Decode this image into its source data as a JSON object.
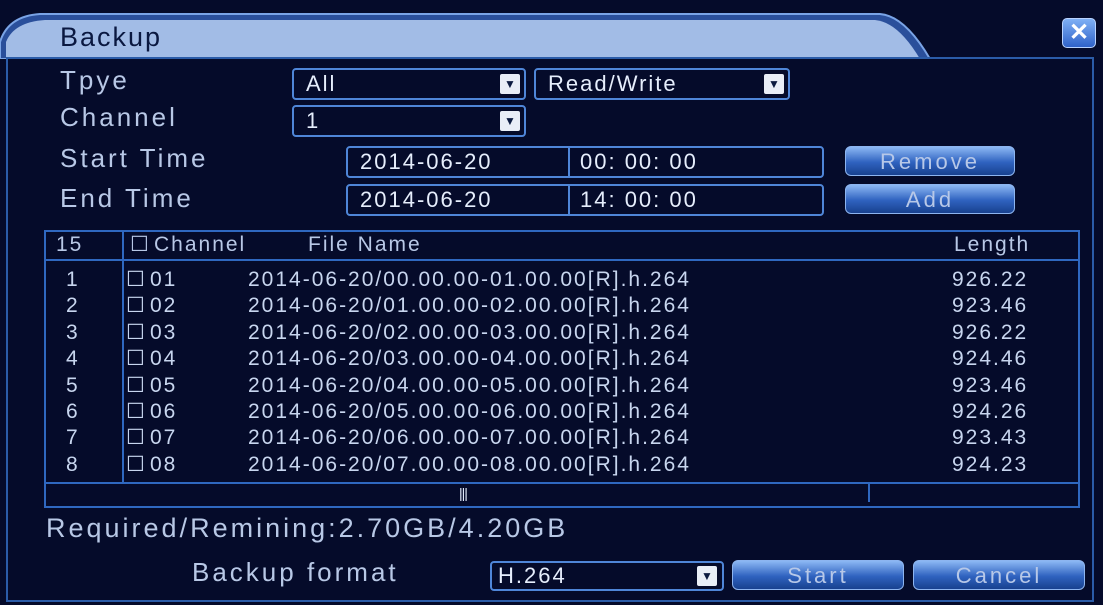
{
  "window": {
    "title": "Backup"
  },
  "form": {
    "type_label": "Tpye",
    "type_value": "All",
    "mode_value": "Read/Write",
    "channel_label": "Channel",
    "channel_value": "1",
    "start_label": "Start Time",
    "start_date": "2014-06-20",
    "start_time": "00: 00: 00",
    "end_label": "End Time",
    "end_date": "2014-06-20",
    "end_time": "14: 00: 00",
    "remove_label": "Remove",
    "add_label": "Add"
  },
  "table": {
    "count": "15",
    "col_channel": "Channel",
    "col_file": "File Name",
    "col_length": "Length",
    "rows": [
      {
        "num": "1",
        "ch": "01",
        "file": "2014-06-20/00.00.00-01.00.00[R].h.264",
        "len": "926.22"
      },
      {
        "num": "2",
        "ch": "02",
        "file": "2014-06-20/01.00.00-02.00.00[R].h.264",
        "len": "923.46"
      },
      {
        "num": "3",
        "ch": "03",
        "file": "2014-06-20/02.00.00-03.00.00[R].h.264",
        "len": "926.22"
      },
      {
        "num": "4",
        "ch": "04",
        "file": "2014-06-20/03.00.00-04.00.00[R].h.264",
        "len": "924.46"
      },
      {
        "num": "5",
        "ch": "05",
        "file": "2014-06-20/04.00.00-05.00.00[R].h.264",
        "len": "923.46"
      },
      {
        "num": "6",
        "ch": "06",
        "file": "2014-06-20/05.00.00-06.00.00[R].h.264",
        "len": "924.26"
      },
      {
        "num": "7",
        "ch": "07",
        "file": "2014-06-20/06.00.00-07.00.00[R].h.264",
        "len": "923.43"
      },
      {
        "num": "8",
        "ch": "08",
        "file": "2014-06-20/07.00.00-08.00.00[R].h.264",
        "len": "924.23"
      }
    ]
  },
  "footer": {
    "required_label": "Required/Remining:",
    "required_value": "2.70GB/4.20GB",
    "format_label": "Backup format",
    "format_value": "H.264",
    "start_label": "Start",
    "cancel_label": "Cancel"
  },
  "icons": {
    "close": "close-icon",
    "dropdown": "chevron-down-icon",
    "checkbox": "checkbox-icon"
  },
  "colors": {
    "background": "#050b2a",
    "accent": "#4f86d8",
    "text": "#b8c8e6"
  }
}
